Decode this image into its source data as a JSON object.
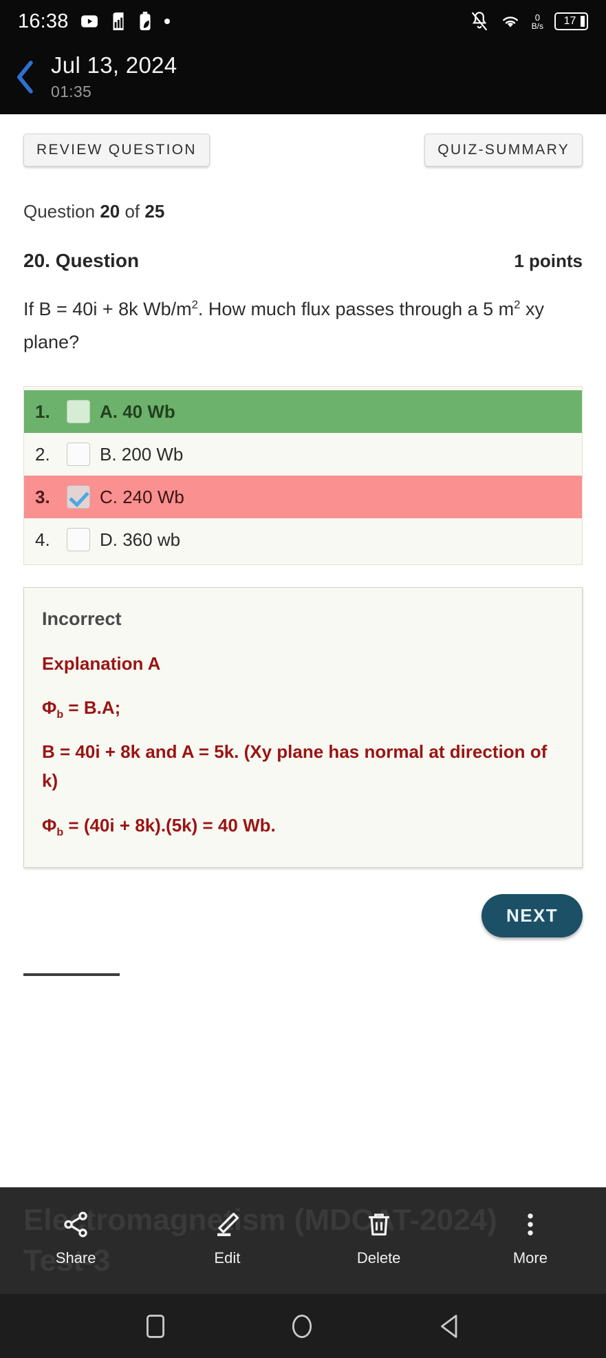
{
  "status_bar": {
    "clock": "16:38",
    "icons": [
      "youtube-icon",
      "recorder-icon",
      "battery-saver-icon",
      "dot-icon"
    ],
    "net_speed_value": "0",
    "net_speed_unit": "B/s",
    "battery_percent": "17",
    "right_icons": [
      "bell-muted-icon",
      "wifi-icon"
    ]
  },
  "header": {
    "date": "Jul 13, 2024",
    "time": "01:35",
    "back_icon": "chevron-left-icon"
  },
  "chips": {
    "review": "REVIEW QUESTION",
    "summary": "QUIZ-SUMMARY"
  },
  "quiz": {
    "progress_prefix": "Question",
    "current": "20",
    "progress_mid": "of",
    "total": "25",
    "question_title": "20. Question",
    "points": "1 points",
    "question_text_line1_a": "If B = 40i + 8k Wb/m",
    "question_text_sup1": "2",
    "question_text_line1_b": ". How much flux passes",
    "question_text_line2_a": "through a 5 m",
    "question_text_sup2": "2",
    "question_text_line2_b": " xy plane?"
  },
  "options": [
    {
      "num": "1.",
      "text": "A. 40 Wb",
      "state": "correct",
      "checked": false
    },
    {
      "num": "2.",
      "text": "B. 200 Wb",
      "state": "normal",
      "checked": false
    },
    {
      "num": "3.",
      "text": "C. 240 Wb",
      "state": "chosen-wrong",
      "checked": true
    },
    {
      "num": "4.",
      "text": "D. 360 wb",
      "state": "normal",
      "checked": false
    }
  ],
  "explanation": {
    "status": "Incorrect",
    "heading": "Explanation A",
    "line_phi1_a": "Φ",
    "line_phi1_sub": "b",
    "line_phi1_b": " = B.A;",
    "line2": "B = 40i + 8k and A = 5k. (Xy plane has normal at direction of k)",
    "line_phi2_a": "Φ",
    "line_phi2_sub": "b",
    "line_phi2_b": " = (40i + 8k).(5k) = 40 Wb."
  },
  "next_button": "NEXT",
  "bottom_bar": {
    "background_title": "Electromagnetism (MDCAT-2024)\nTest-3",
    "actions": [
      {
        "label": "Share",
        "icon": "share-icon"
      },
      {
        "label": "Edit",
        "icon": "pencil-icon"
      },
      {
        "label": "Delete",
        "icon": "trash-icon"
      },
      {
        "label": "More",
        "icon": "more-vertical-icon"
      }
    ]
  },
  "nav_bar": {
    "buttons": [
      {
        "icon": "recents-square-icon"
      },
      {
        "icon": "home-circle-icon"
      },
      {
        "icon": "back-triangle-icon"
      }
    ]
  },
  "colors": {
    "correct_green": "#6cb26c",
    "wrong_red": "#fa9090",
    "explanation_red": "#9b1414",
    "next_button": "#1c5067",
    "accent_blue": "#2f6fd0"
  }
}
